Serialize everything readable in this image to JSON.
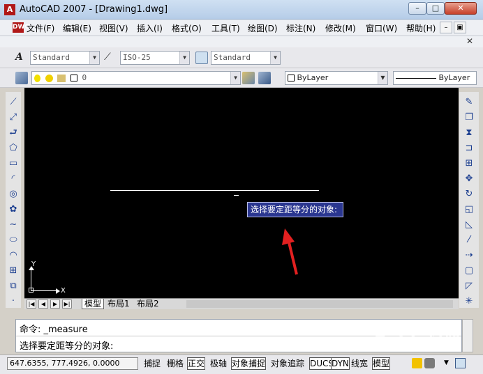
{
  "window": {
    "title": "AutoCAD 2007 - [Drawing1.dwg]",
    "app_icon": "A",
    "min": "–",
    "max": "□",
    "close": "✕"
  },
  "menubar": {
    "doc_icon": "DWG",
    "items": [
      "文件(F)",
      "编辑(E)",
      "视图(V)",
      "插入(I)",
      "格式(O)",
      "工具(T)",
      "绘图(D)",
      "标注(N)",
      "修改(M)",
      "窗口(W)",
      "帮助(H)"
    ],
    "mdi_min": "–",
    "mdi_restore": "▣",
    "doc_close": "✕"
  },
  "styles_toolbar": {
    "text_style": "Standard",
    "dim_style": "ISO-25",
    "table_style": "Standard"
  },
  "layers_toolbar": {
    "layer": "0",
    "color": "ByLayer",
    "linetype": "ByLayer"
  },
  "canvas": {
    "prompt_tooltip": "选择要定距等分的对象:",
    "ucs_x": "X",
    "ucs_y": "Y"
  },
  "tabs": {
    "model": "模型",
    "layout1": "布局1",
    "layout2": "布局2",
    "nav": [
      "|◀",
      "◀",
      "▶",
      "▶|"
    ]
  },
  "command": {
    "line1": "命令: _measure",
    "line2": "选择要定距等分的对象:"
  },
  "status": {
    "coords": "647.6355, 777.4926, 0.0000",
    "toggles": [
      {
        "label": "捕捉",
        "on": false
      },
      {
        "label": "栅格",
        "on": false
      },
      {
        "label": "正交",
        "on": true
      },
      {
        "label": "极轴",
        "on": false
      },
      {
        "label": "对象捕捉",
        "on": true
      },
      {
        "label": "对象追踪",
        "on": false
      },
      {
        "label": "DUCS",
        "on": true
      },
      {
        "label": "DYN",
        "on": true
      },
      {
        "label": "线宽",
        "on": false
      },
      {
        "label": "模型",
        "on": true
      }
    ]
  },
  "watermark": "Baidu经验",
  "colors": {
    "canvas": "#000000",
    "tooltip_bg": "#2a3690",
    "arrow": "#e32020"
  }
}
